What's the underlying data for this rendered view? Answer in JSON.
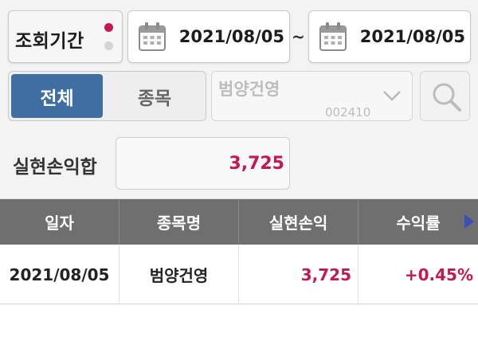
{
  "period": {
    "label": "조회기간"
  },
  "date_range": {
    "from": "2021/08/05",
    "separator": "~",
    "to": "2021/08/05"
  },
  "filter": {
    "all_label": "전체",
    "stock_label": "종목",
    "selected": "all"
  },
  "stock": {
    "name": "범양건영",
    "code": "002410"
  },
  "summary": {
    "label": "실현손익합",
    "value": "3,725"
  },
  "table": {
    "headers": [
      "일자",
      "종목명",
      "실현손익",
      "수익률"
    ],
    "rows": [
      {
        "date": "2021/08/05",
        "name": "범양건영",
        "pnl": "3,725",
        "return": "+0.45%"
      }
    ]
  },
  "colors": {
    "accent": "#c4184f",
    "selected_tab": "#3f6ea3",
    "header_bg": "#6f6f6f"
  }
}
